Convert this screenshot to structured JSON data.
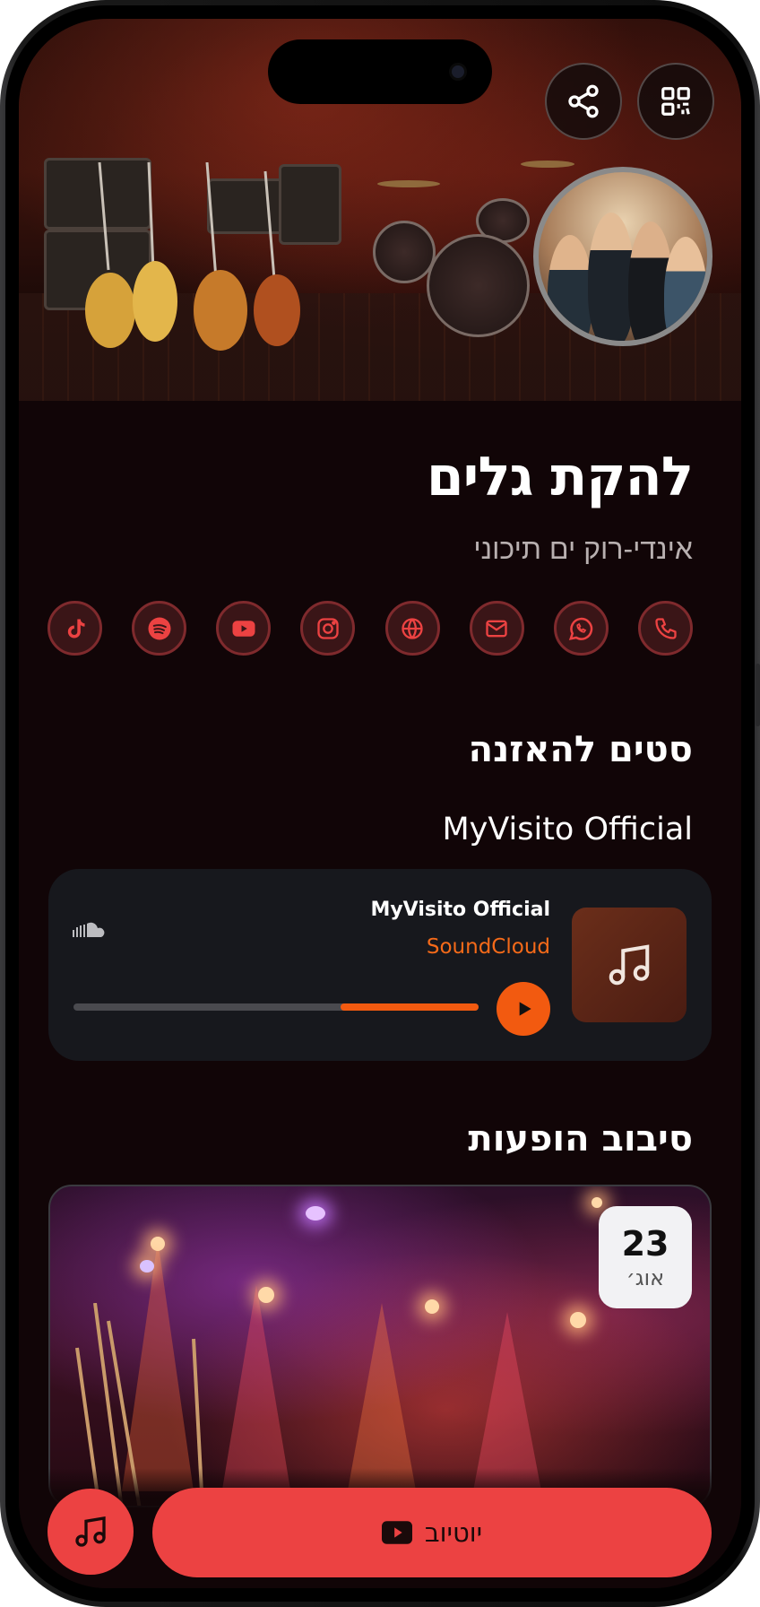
{
  "profile": {
    "band_name": "להקת גלים",
    "tagline": "אינדי-רוק ים תיכוני"
  },
  "header_actions": {
    "share_icon": "share-icon",
    "qr_icon": "qr-code-icon"
  },
  "socials": [
    {
      "icon": "phone-icon"
    },
    {
      "icon": "whatsapp-icon"
    },
    {
      "icon": "mail-icon"
    },
    {
      "icon": "globe-icon"
    },
    {
      "icon": "instagram-icon"
    },
    {
      "icon": "youtube-icon"
    },
    {
      "icon": "spotify-icon"
    },
    {
      "icon": "tiktok-icon"
    }
  ],
  "listen": {
    "section_title": "סטים להאזנה",
    "playlist_name": "MyVisito Official",
    "player": {
      "track_title": "MyVisito Official",
      "source": "SoundCloud",
      "progress": 0.34
    }
  },
  "tour": {
    "section_title": "סיבוב הופעות",
    "event": {
      "day": "23",
      "month": "אוג׳"
    }
  },
  "bottom": {
    "youtube_label": "יוטיוב"
  },
  "colors": {
    "accent": "#ec4242",
    "soundcloud": "#f25a10",
    "background": "#110507"
  }
}
